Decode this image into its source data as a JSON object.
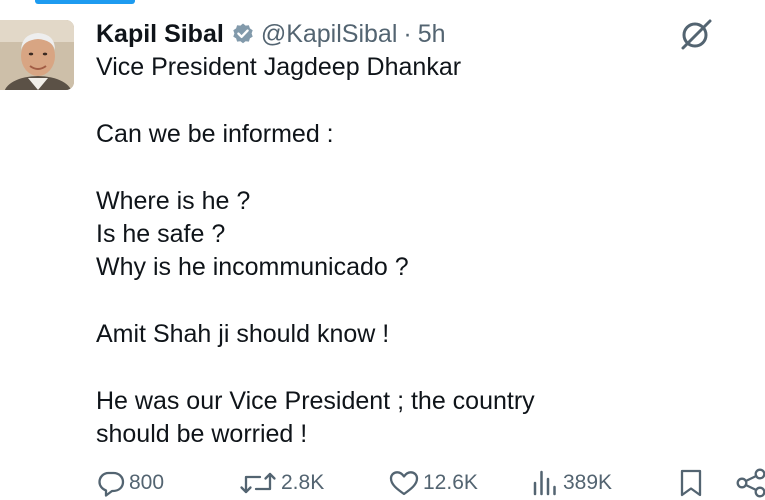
{
  "author": {
    "display_name": "Kapil Sibal",
    "handle": "@KapilSibal",
    "separator": "·",
    "time": "5h"
  },
  "icons": {
    "avatar": "profile-photo",
    "verified": "verified-badge-icon",
    "grok": "grok-icon",
    "reply": "reply-icon",
    "repost": "repost-icon",
    "like": "heart-icon",
    "views": "views-chart-icon",
    "bookmark": "bookmark-icon",
    "share": "share-icon"
  },
  "tweet": {
    "lines": [
      "Vice President Jagdeep Dhankar",
      "",
      "Can we be informed :",
      "",
      "Where is he ?",
      "Is he safe ?",
      "Why is he incommunicado ?",
      "",
      "Amit Shah ji should know !",
      "",
      "He was our Vice President ; the country",
      "should be worried !"
    ]
  },
  "stats": {
    "replies": "800",
    "reposts": "2.8K",
    "likes": "12.6K",
    "views": "389K"
  },
  "colors": {
    "text": "#0f1419",
    "secondary": "#536471",
    "accent": "#1d9bf0",
    "verified_badge": "#829aab"
  }
}
